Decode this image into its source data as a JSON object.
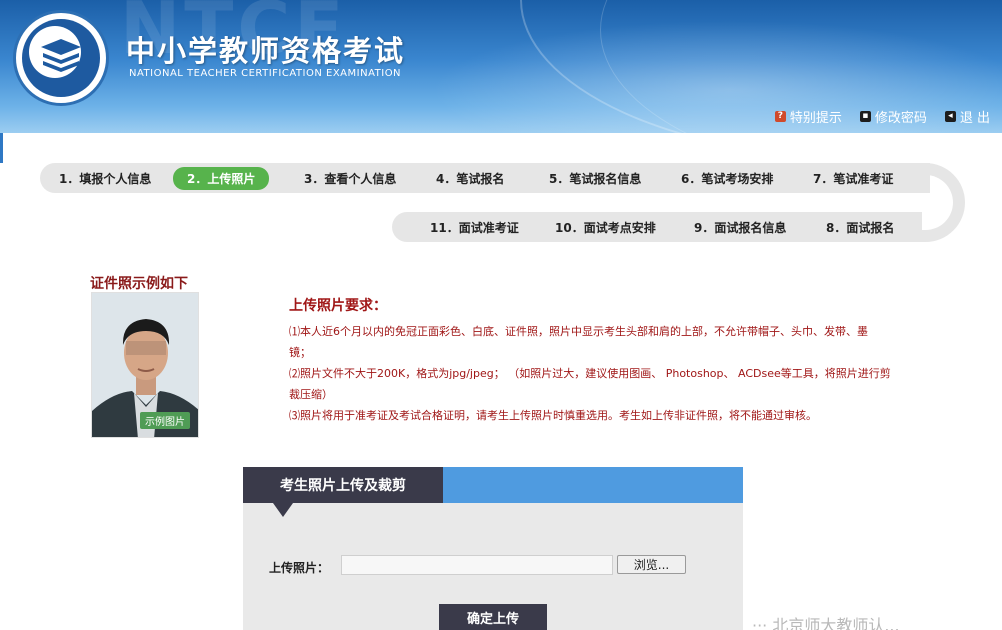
{
  "header": {
    "title": "中小学教师资格考试",
    "subtitle": "NATIONAL TEACHER CERTIFICATION EXAMINATION",
    "watermark": "NTCE",
    "logo_icon": "ntce-book-logo",
    "links": [
      {
        "label": "特别提示",
        "icon": "tip-icon"
      },
      {
        "label": "修改密码",
        "icon": "key-icon"
      },
      {
        "label": "退 出",
        "icon": "exit-icon"
      }
    ]
  },
  "steps": {
    "row1": [
      "1．填报个人信息",
      "2．上传照片",
      "3．查看个人信息",
      "4．笔试报名",
      "5．笔试报名信息",
      "6．笔试考场安排",
      "7．笔试准考证"
    ],
    "row2": [
      "11．面试准考证",
      "10．面试考点安排",
      "9．面试报名信息",
      "8．面试报名"
    ],
    "active_color": "#57b34c"
  },
  "sample": {
    "title": "证件照示例如下",
    "badge": "示例图片"
  },
  "requirements": {
    "title": "上传照片要求：",
    "items": [
      "⑴本人近6个月以内的免冠正面彩色、白底、证件照，照片中显示考生头部和肩的上部，不允许带帽子、头巾、发带、墨",
      "镜；",
      "⑵照片文件不大于200K，格式为jpg/jpeg； （如照片过大，建议使用图画、 Photoshop、 ACDsee等工具，将照片进行剪",
      "裁压缩）",
      "⑶照片将用于准考证及考试合格证明，请考生上传照片时慎重选用。考生如上传非证件照，将不能通过审核。"
    ]
  },
  "upload": {
    "panel_title": "考生照片上传及裁剪",
    "field_label": "上传照片：",
    "file_value": "",
    "browse_label": "浏览...",
    "confirm_label": "确定上传"
  },
  "watermark_bottom": "··· 北京师大教师认..."
}
